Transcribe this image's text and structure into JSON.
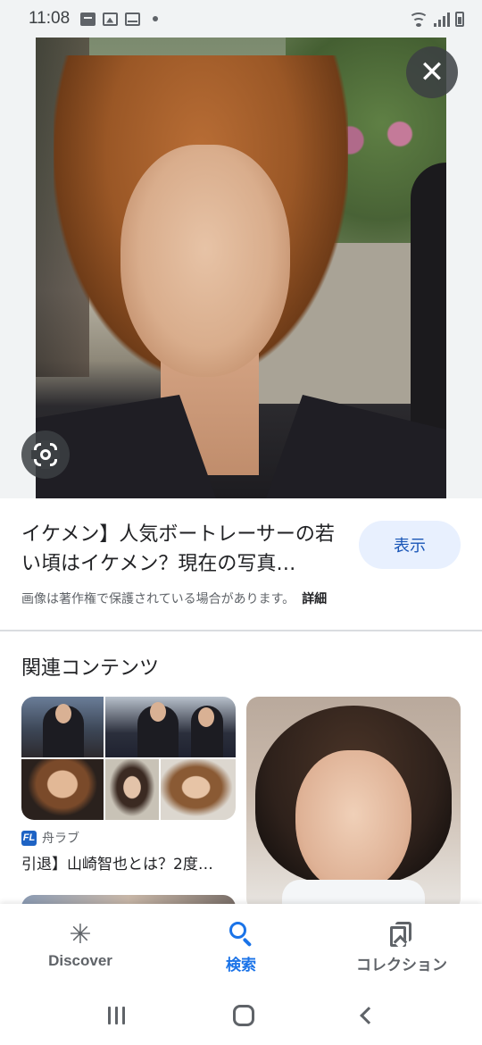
{
  "status_bar": {
    "time": "11:08",
    "icons": [
      "pay-icon",
      "image-icon",
      "mail-icon",
      "notification-dot"
    ],
    "right_icons": [
      "wifi-icon",
      "signal-icon",
      "battery-icon"
    ]
  },
  "viewer": {
    "close_glyph": "✕",
    "lens_icon": "google-lens-icon"
  },
  "result": {
    "title": "イケメン】人気ボートレーサーの若い頃はイケメン？現在の写真…",
    "show_button": "表示",
    "copyright_notice": "画像は著作権で保護されている場合があります。",
    "details_link": "詳細"
  },
  "related": {
    "heading": "関連コンテンツ",
    "cards": [
      {
        "source_logo": "FL",
        "source_name": "舟ラブ",
        "title": "引退】山崎智也とは？2度…"
      }
    ]
  },
  "bottom_nav": {
    "items": [
      {
        "label": "Discover",
        "icon": "asterisk-icon",
        "glyph": "✳"
      },
      {
        "label": "検索",
        "icon": "search-icon"
      },
      {
        "label": "コレクション",
        "icon": "collections-icon"
      }
    ],
    "active_index": 1
  },
  "colors": {
    "accent": "#1a73e8",
    "button_bg": "#e8f0fe",
    "button_text": "#1a56b7",
    "text_primary": "#202124",
    "text_secondary": "#5f6368"
  }
}
